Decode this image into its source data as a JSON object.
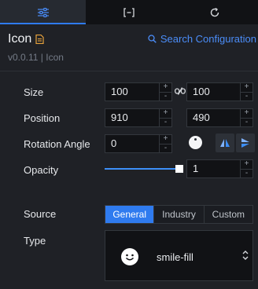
{
  "tabs": [
    {
      "name": "settings",
      "icon": "sliders-icon",
      "active": true
    },
    {
      "name": "data",
      "icon": "bracket-icon",
      "active": false
    },
    {
      "name": "interaction",
      "icon": "refresh-icon",
      "active": false
    }
  ],
  "header": {
    "title": "Icon",
    "version": "v0.0.11 | Icon",
    "search_link": "Search Configuration"
  },
  "size": {
    "label": "Size",
    "width": "100",
    "height": "100"
  },
  "position": {
    "label": "Position",
    "x": "910",
    "y": "490"
  },
  "rotation": {
    "label": "Rotation Angle",
    "value": "0"
  },
  "opacity": {
    "label": "Opacity",
    "value": "1",
    "level": 1
  },
  "source": {
    "label": "Source",
    "options": [
      "General",
      "Industry",
      "Custom"
    ],
    "selected": "General"
  },
  "type": {
    "label": "Type",
    "value": "smile-fill",
    "icon": "smile-fill-icon"
  },
  "stepper": {
    "plus": "+",
    "minus": "-"
  },
  "colors": {
    "accent": "#2f7bef",
    "background": "#1f2126",
    "input": "#111215",
    "doc_icon": "#e6a23c"
  }
}
